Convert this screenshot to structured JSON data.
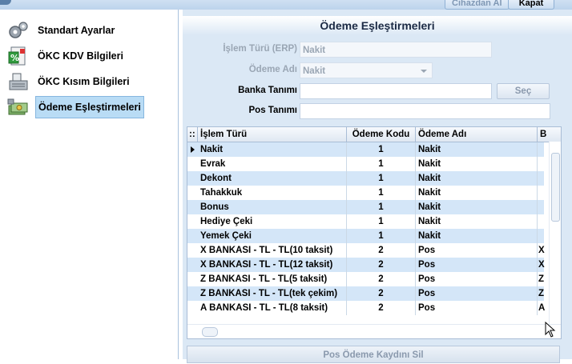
{
  "top_buttons": {
    "device_label": "Cihazdan Al",
    "close_label": "Kapat"
  },
  "sidebar": {
    "items": [
      {
        "label": "Standart Ayarlar",
        "icon": "gears-icon"
      },
      {
        "label": "ÖKC KDV Bilgileri",
        "icon": "percent-document-icon"
      },
      {
        "label": "ÖKC Kısım Bilgileri",
        "icon": "cash-register-icon"
      },
      {
        "label": "Ödeme Eşleştirmeleri",
        "icon": "money-icon",
        "active": true
      }
    ]
  },
  "panel": {
    "title": "Ödeme Eşleştirmeleri",
    "form": {
      "islem_turu_label": "İşlem Türü (ERP)",
      "islem_turu_value": "Nakit",
      "odeme_adi_label": "Ödeme Adı",
      "odeme_adi_value": "Nakit",
      "banka_label": "Banka Tanımı",
      "banka_value": "",
      "sec_label": "Seç",
      "pos_label": "Pos Tanımı",
      "pos_value": ""
    },
    "grid": {
      "columns": [
        "İşlem Türü",
        "Ödeme Kodu",
        "Ödeme Adı",
        "B"
      ],
      "rows": [
        {
          "islem": "Nakit",
          "kod": "1",
          "ad": "Nakit",
          "b": ""
        },
        {
          "islem": "Evrak",
          "kod": "1",
          "ad": "Nakit",
          "b": ""
        },
        {
          "islem": "Dekont",
          "kod": "1",
          "ad": "Nakit",
          "b": ""
        },
        {
          "islem": "Tahakkuk",
          "kod": "1",
          "ad": "Nakit",
          "b": ""
        },
        {
          "islem": "Bonus",
          "kod": "1",
          "ad": "Nakit",
          "b": ""
        },
        {
          "islem": "Hediye Çeki",
          "kod": "1",
          "ad": "Nakit",
          "b": ""
        },
        {
          "islem": "Yemek Çeki",
          "kod": "1",
          "ad": "Nakit",
          "b": ""
        },
        {
          "islem": "X BANKASI - TL - TL(10 taksit)",
          "kod": "2",
          "ad": "Pos",
          "b": "X"
        },
        {
          "islem": "X BANKASI - TL - TL(12 taksit)",
          "kod": "2",
          "ad": "Pos",
          "b": "X"
        },
        {
          "islem": "Z BANKASI - TL - TL(5 taksit)",
          "kod": "2",
          "ad": "Pos",
          "b": "Z"
        },
        {
          "islem": "Z BANKASI - TL - TL(tek çekim)",
          "kod": "2",
          "ad": "Pos",
          "b": "Z"
        },
        {
          "islem": "A BANKASI - TL - TL(8 taksit)",
          "kod": "2",
          "ad": "Pos",
          "b": "A"
        }
      ]
    },
    "delete_button_label": "Pos Ödeme Kaydını Sil"
  },
  "colors": {
    "panel_bg": "#dbe8f5",
    "row_alt": "#d4e6f8",
    "active_item": "#b9dcf5"
  }
}
